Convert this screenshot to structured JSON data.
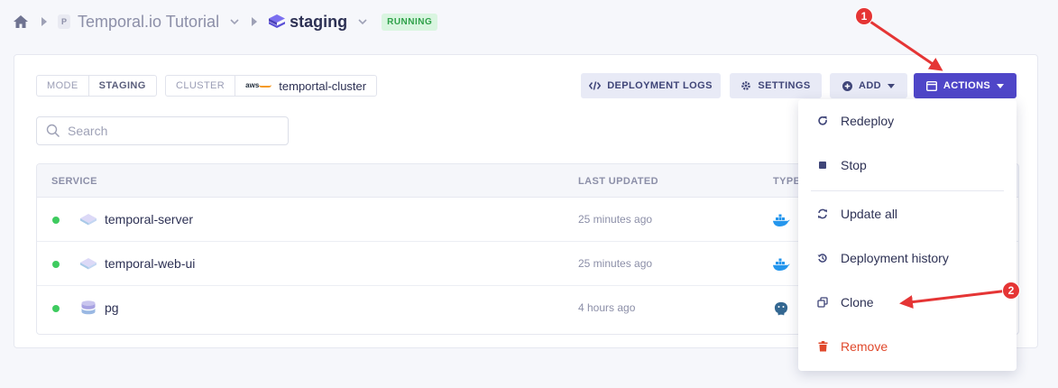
{
  "breadcrumb": {
    "project_badge": "P",
    "project": "Temporal.io Tutorial",
    "environment": "staging",
    "status": "RUNNING"
  },
  "tags": {
    "mode_key": "MODE",
    "mode_value": "STAGING",
    "cluster_key": "CLUSTER",
    "cluster_provider": "aws",
    "cluster_value": "temportal-cluster"
  },
  "toolbar": {
    "deployment_logs": "DEPLOYMENT LOGS",
    "settings": "SETTINGS",
    "add": "ADD",
    "actions": "ACTIONS"
  },
  "search": {
    "placeholder": "Search"
  },
  "table": {
    "columns": [
      "SERVICE",
      "LAST UPDATED",
      "TYPE"
    ],
    "rows": [
      {
        "name": "temporal-server",
        "updated": "25 minutes ago",
        "type_icon": "docker-icon",
        "status": "running"
      },
      {
        "name": "temporal-web-ui",
        "updated": "25 minutes ago",
        "type_icon": "docker-icon",
        "status": "running"
      },
      {
        "name": "pg",
        "updated": "4 hours ago",
        "type_icon": "postgres-icon",
        "status": "running"
      }
    ]
  },
  "actions_menu": {
    "items": [
      {
        "label": "Redeploy",
        "icon": "redeploy-icon"
      },
      {
        "label": "Stop",
        "icon": "stop-icon"
      },
      {
        "label": "Update all",
        "icon": "update-icon"
      },
      {
        "label": "Deployment history",
        "icon": "history-icon"
      },
      {
        "label": "Clone",
        "icon": "clone-icon"
      },
      {
        "label": "Remove",
        "icon": "trash-icon"
      }
    ]
  },
  "annotations": {
    "step1": "1",
    "step2": "2"
  },
  "colors": {
    "primary": "#4f46c8",
    "success": "#3ecb5f",
    "danger": "#e0492c",
    "annotation": "#e53535"
  }
}
